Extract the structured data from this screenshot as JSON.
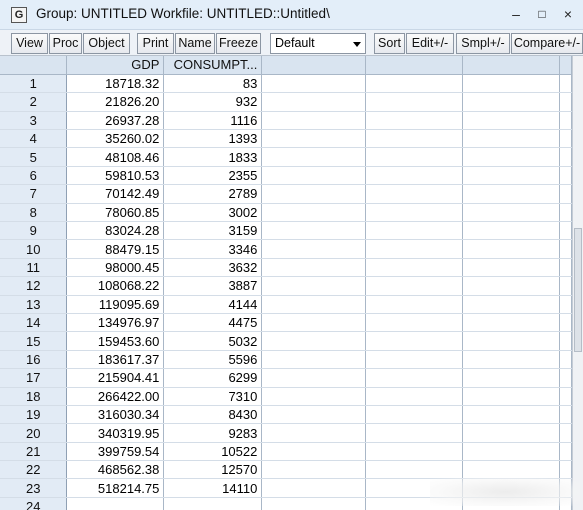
{
  "window": {
    "icon_letter": "G",
    "title": "Group: UNTITLED   Workfile: UNTITLED::Untitled\\",
    "controls": {
      "minimize": "–",
      "maximize": "□",
      "close": "×"
    }
  },
  "toolbar": {
    "view": "View",
    "proc": "Proc",
    "object": "Object",
    "print": "Print",
    "name": "Name",
    "freeze": "Freeze",
    "dropdown_value": "Default",
    "sort": "Sort",
    "edit": "Edit+/-",
    "smpl": "Smpl+/-",
    "compare": "Compare+/-"
  },
  "grid": {
    "columns": [
      "GDP",
      "CONSUMPT..."
    ],
    "rows": [
      {
        "obs": "1",
        "gdp": "18718.32",
        "consumption": "83"
      },
      {
        "obs": "2",
        "gdp": "21826.20",
        "consumption": "932"
      },
      {
        "obs": "3",
        "gdp": "26937.28",
        "consumption": "1116"
      },
      {
        "obs": "4",
        "gdp": "35260.02",
        "consumption": "1393"
      },
      {
        "obs": "5",
        "gdp": "48108.46",
        "consumption": "1833"
      },
      {
        "obs": "6",
        "gdp": "59810.53",
        "consumption": "2355"
      },
      {
        "obs": "7",
        "gdp": "70142.49",
        "consumption": "2789"
      },
      {
        "obs": "8",
        "gdp": "78060.85",
        "consumption": "3002"
      },
      {
        "obs": "9",
        "gdp": "83024.28",
        "consumption": "3159"
      },
      {
        "obs": "10",
        "gdp": "88479.15",
        "consumption": "3346"
      },
      {
        "obs": "11",
        "gdp": "98000.45",
        "consumption": "3632"
      },
      {
        "obs": "12",
        "gdp": "108068.22",
        "consumption": "3887"
      },
      {
        "obs": "13",
        "gdp": "119095.69",
        "consumption": "4144"
      },
      {
        "obs": "14",
        "gdp": "134976.97",
        "consumption": "4475"
      },
      {
        "obs": "15",
        "gdp": "159453.60",
        "consumption": "5032"
      },
      {
        "obs": "16",
        "gdp": "183617.37",
        "consumption": "5596"
      },
      {
        "obs": "17",
        "gdp": "215904.41",
        "consumption": "6299"
      },
      {
        "obs": "18",
        "gdp": "266422.00",
        "consumption": "7310"
      },
      {
        "obs": "19",
        "gdp": "316030.34",
        "consumption": "8430"
      },
      {
        "obs": "20",
        "gdp": "340319.95",
        "consumption": "9283"
      },
      {
        "obs": "21",
        "gdp": "399759.54",
        "consumption": "10522"
      },
      {
        "obs": "22",
        "gdp": "468562.38",
        "consumption": "12570"
      },
      {
        "obs": "23",
        "gdp": "518214.75",
        "consumption": "14110"
      },
      {
        "obs": "24",
        "gdp": "",
        "consumption": ""
      }
    ]
  }
}
